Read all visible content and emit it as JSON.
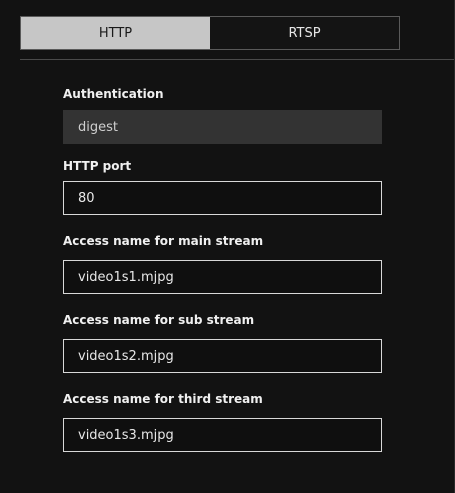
{
  "tabs": [
    {
      "label": "HTTP",
      "active": true
    },
    {
      "label": "RTSP",
      "active": false
    }
  ],
  "fields": {
    "authentication": {
      "label": "Authentication",
      "value": "digest"
    },
    "http_port": {
      "label": "HTTP port",
      "value": "80"
    },
    "main_stream": {
      "label": "Access name for main stream",
      "value": "video1s1.mjpg"
    },
    "sub_stream": {
      "label": "Access name for sub stream",
      "value": "video1s2.mjpg"
    },
    "third_stream": {
      "label": "Access name for third stream",
      "value": "video1s3.mjpg"
    }
  },
  "colors": {
    "background": "#121212",
    "active_tab": "#c6c6c6",
    "readonly_field": "#333333",
    "field_border": "#d8d8d8"
  }
}
